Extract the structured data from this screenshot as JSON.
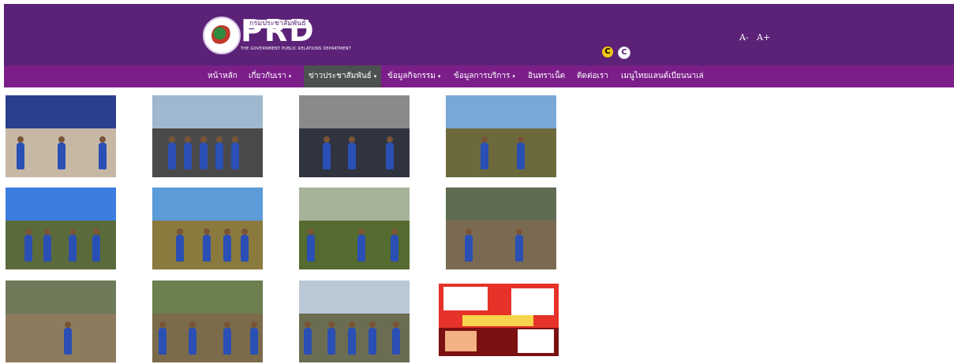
{
  "header": {
    "logo_text": "PRD",
    "logo_thai": "กรมประชาสัมพันธ์",
    "logo_subtitle": "THE GOVERNMENT PUBLIC RELATIONS DEPARTMENT",
    "font_decrease": "A-",
    "font_increase": "A+",
    "contrast_yellow": "C",
    "contrast_white": "C"
  },
  "nav": {
    "items": [
      {
        "label": "หน้าหลัก",
        "has_caret": false
      },
      {
        "label": "เกี่ยวกับเรา",
        "has_caret": true
      },
      {
        "label": "ข่าวประชาสัมพันธ์",
        "has_caret": true,
        "active": true
      },
      {
        "label": "ข้อมูลกิจกรรม",
        "has_caret": true
      },
      {
        "label": "ข้อมูลการบริการ",
        "has_caret": true
      },
      {
        "label": "อินทราเน็ต",
        "has_caret": false
      },
      {
        "label": "ติดต่อเรา",
        "has_caret": false
      },
      {
        "label": "เมนูไทยแลนด์เบียนนาเล่",
        "has_caret": false
      }
    ],
    "caret_glyph": "▾"
  },
  "gallery": {
    "rows": 3,
    "columns": 4,
    "items": [
      {
        "name": "photo-press-conference",
        "sky": "#2b3f8f",
        "ground": "#c7b8a6"
      },
      {
        "name": "photo-group-pavilion",
        "sky": "#9fb8cf",
        "ground": "#4a4a4a"
      },
      {
        "name": "photo-seated-audience",
        "sky": "#8a8a8a",
        "ground": "#2f3440"
      },
      {
        "name": "photo-planting-hillside",
        "sky": "#79a8d8",
        "ground": "#6c6a3c"
      },
      {
        "name": "photo-group-field-sky",
        "sky": "#3d7de0",
        "ground": "#5b6a3a"
      },
      {
        "name": "photo-workers-mountain",
        "sky": "#5a9bd8",
        "ground": "#8a7a3e"
      },
      {
        "name": "photo-handshake-field",
        "sky": "#a6b39a",
        "ground": "#556b2f"
      },
      {
        "name": "photo-forest-path",
        "sky": "#5f6b52",
        "ground": "#7a6a52"
      },
      {
        "name": "photo-forest-tree-check",
        "sky": "#6f7a5a",
        "ground": "#8d7b5e"
      },
      {
        "name": "photo-group-in-woods",
        "sky": "#6b7f4f",
        "ground": "#7b6b4b"
      },
      {
        "name": "photo-team-under-pines",
        "sky": "#b9c8d4",
        "ground": "#6a6d52"
      },
      {
        "name": "photo-infographic-poster",
        "sky": "#e63228",
        "ground": "#7a1010"
      }
    ]
  }
}
